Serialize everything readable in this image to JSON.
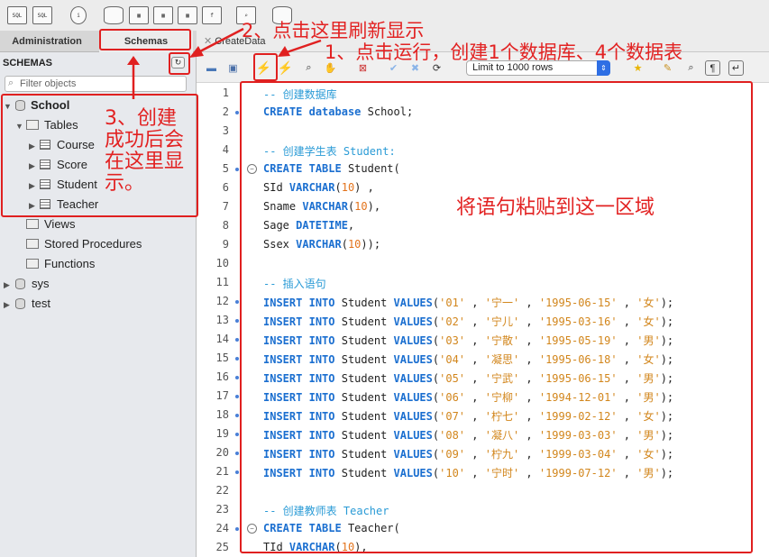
{
  "toolbar_icons": [
    "sql-new-icon",
    "sql-open-icon",
    "info-icon",
    "database-icon",
    "table-icon",
    "view-icon",
    "procedure-icon",
    "function-icon",
    "search-icon",
    "reconnect-icon"
  ],
  "left_tabs": {
    "administration": "Administration",
    "schemas": "Schemas"
  },
  "editor_tab": "CreateData",
  "schemas_header": "SCHEMAS",
  "filter_placeholder": "Filter objects",
  "tree": {
    "school": "School",
    "tables": "Tables",
    "tables_list": [
      "Course",
      "Score",
      "Student",
      "Teacher"
    ],
    "views": "Views",
    "procedures": "Stored Procedures",
    "functions": "Functions",
    "sys": "sys",
    "test": "test"
  },
  "limit_select": "Limit to 1000 rows",
  "annotations": {
    "a1": "1、点击运行，创建1个数据库、4个数据表",
    "a2": "2、点击这里刷新显示",
    "a3_lines": [
      "3、创建",
      "成功后会",
      "在这里显",
      "示。"
    ],
    "a4": "将语句粘贴到这一区域"
  },
  "code": {
    "lines": [
      {
        "n": "1",
        "t": "-- 创建数据库"
      },
      {
        "n": "2",
        "t": "CREATE database School;"
      },
      {
        "n": "3",
        "t": ""
      },
      {
        "n": "4",
        "t": "-- 创建学生表 Student:"
      },
      {
        "n": "5",
        "t": "CREATE TABLE Student("
      },
      {
        "n": "6",
        "t": "SId VARCHAR(10) ,"
      },
      {
        "n": "7",
        "t": "Sname VARCHAR(10),"
      },
      {
        "n": "8",
        "t": "Sage DATETIME,"
      },
      {
        "n": "9",
        "t": "Ssex VARCHAR(10));"
      },
      {
        "n": "10",
        "t": ""
      },
      {
        "n": "11",
        "t": "-- 插入语句"
      },
      {
        "n": "12",
        "t": "INSERT INTO Student VALUES('01' , '宁一' , '1995-06-15' , '女');"
      },
      {
        "n": "13",
        "t": "INSERT INTO Student VALUES('02' , '宁儿' , '1995-03-16' , '女');"
      },
      {
        "n": "14",
        "t": "INSERT INTO Student VALUES('03' , '宁散' , '1995-05-19' , '男');"
      },
      {
        "n": "15",
        "t": "INSERT INTO Student VALUES('04' , '凝思' , '1995-06-18' , '女');"
      },
      {
        "n": "16",
        "t": "INSERT INTO Student VALUES('05' , '宁武' , '1995-06-15' , '男');"
      },
      {
        "n": "17",
        "t": "INSERT INTO Student VALUES('06' , '宁柳' , '1994-12-01' , '男');"
      },
      {
        "n": "18",
        "t": "INSERT INTO Student VALUES('07' , '柠七' , '1999-02-12' , '女');"
      },
      {
        "n": "19",
        "t": "INSERT INTO Student VALUES('08' , '凝八' , '1999-03-03' , '男');"
      },
      {
        "n": "20",
        "t": "INSERT INTO Student VALUES('09' , '柠九' , '1999-03-04' , '女');"
      },
      {
        "n": "21",
        "t": "INSERT INTO Student VALUES('10' , '宁时' , '1999-07-12' , '男');"
      },
      {
        "n": "22",
        "t": ""
      },
      {
        "n": "23",
        "t": "-- 创建教师表 Teacher"
      },
      {
        "n": "24",
        "t": "CREATE TABLE Teacher("
      },
      {
        "n": "25",
        "t": "TId VARCHAR(10),"
      }
    ],
    "dot_lines": [
      "2",
      "5",
      "12",
      "13",
      "14",
      "15",
      "16",
      "17",
      "18",
      "19",
      "20",
      "21",
      "24"
    ],
    "fold_lines": [
      "5",
      "24"
    ]
  },
  "colors": {
    "annotation": "#e02020",
    "keyword": "#1b6fd0",
    "string": "#d2861c",
    "comment": "#2a9bd6"
  }
}
